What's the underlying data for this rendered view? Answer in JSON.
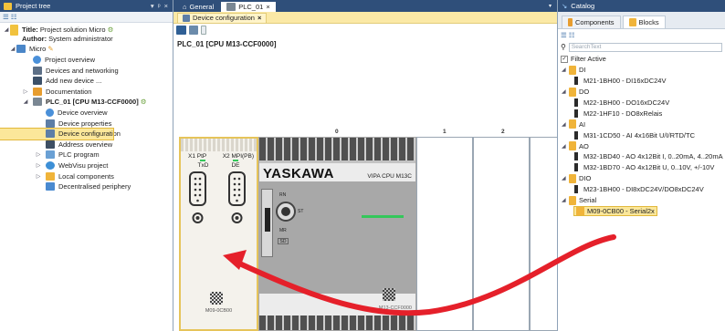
{
  "left_panel": {
    "title": "Project tree",
    "pin": "▾ ᵖ ×",
    "tree": [
      {
        "label": "Title:",
        "extra": "Project solution Micro",
        "bold_extra": false,
        "indent": 0
      },
      {
        "label": "Author:",
        "extra": "System administrator",
        "indent": 0
      },
      {
        "label": "Micro",
        "indent": 1
      },
      {
        "label": "Project overview",
        "indent": 2
      },
      {
        "label": "Devices and networking",
        "indent": 2
      },
      {
        "label": "Add new device ...",
        "indent": 2
      },
      {
        "label": "Documentation",
        "indent": 2
      },
      {
        "label": "PLC_01 [CPU M13-CCF0000]",
        "indent": 2
      },
      {
        "label": "Device overview",
        "indent": 3
      },
      {
        "label": "Device properties",
        "indent": 3
      },
      {
        "label": "Device configuration",
        "indent": 3
      },
      {
        "label": "Address overview",
        "indent": 3
      },
      {
        "label": "PLC program",
        "indent": 3
      },
      {
        "label": "WebVisu project",
        "indent": 3
      },
      {
        "label": "Local components",
        "indent": 3
      },
      {
        "label": "Decentralised periphery",
        "indent": 3
      }
    ]
  },
  "center": {
    "tabs": [
      "General",
      "PLC_01"
    ],
    "subtab": "Device configuration",
    "title": "PLC_01 [CPU M13-CCF0000]",
    "slots": [
      "0",
      "1",
      "2"
    ],
    "module": {
      "port1": "X1 PtP",
      "port1_sub": "TxD",
      "port2": "X2 MPI(PB)",
      "port2_sub": "DE",
      "label": "M09-0CB00"
    },
    "cpu": {
      "brand": "YASKAWA",
      "model": "VIPA CPU M13C",
      "rn": "RN",
      "st": "ST",
      "mr": "MR",
      "sd": "SD",
      "label": "M13-CCF0000"
    }
  },
  "right_panel": {
    "title": "Catalog",
    "tabs": [
      "Components",
      "Blocks"
    ],
    "search_placeholder": "SearchText",
    "filter": "Filter Active",
    "items": [
      {
        "label": "DI",
        "group": true
      },
      {
        "label": "M21-1BH00 - DI16xDC24V",
        "group": false
      },
      {
        "label": "DO",
        "group": true
      },
      {
        "label": "M22-1BH00 - DO16xDC24V",
        "group": false
      },
      {
        "label": "M22-1HF10 - DO8xRelais",
        "group": false
      },
      {
        "label": "AI",
        "group": true
      },
      {
        "label": "M31-1CD50 - AI 4x16Bit U/I/RTD/TC",
        "group": false
      },
      {
        "label": "AO",
        "group": true
      },
      {
        "label": "M32-1BD40 - AO 4x12Bit I, 0..20mA, 4..20mA",
        "group": false
      },
      {
        "label": "M32-1BD70 - AO 4x12Bit U, 0..10V, +/-10V",
        "group": false
      },
      {
        "label": "DIO",
        "group": true
      },
      {
        "label": "M23-1BH00 - DI8xDC24V/DO8xDC24V",
        "group": false
      },
      {
        "label": "Serial",
        "group": true
      },
      {
        "label": "M09-0CB00 - Serial2x",
        "group": false,
        "selected": true
      }
    ]
  },
  "colors": {
    "header": "#2f4f7a",
    "selection": "#fbe79a",
    "arrow": "#e5202a",
    "led_green": "#34c75a"
  }
}
